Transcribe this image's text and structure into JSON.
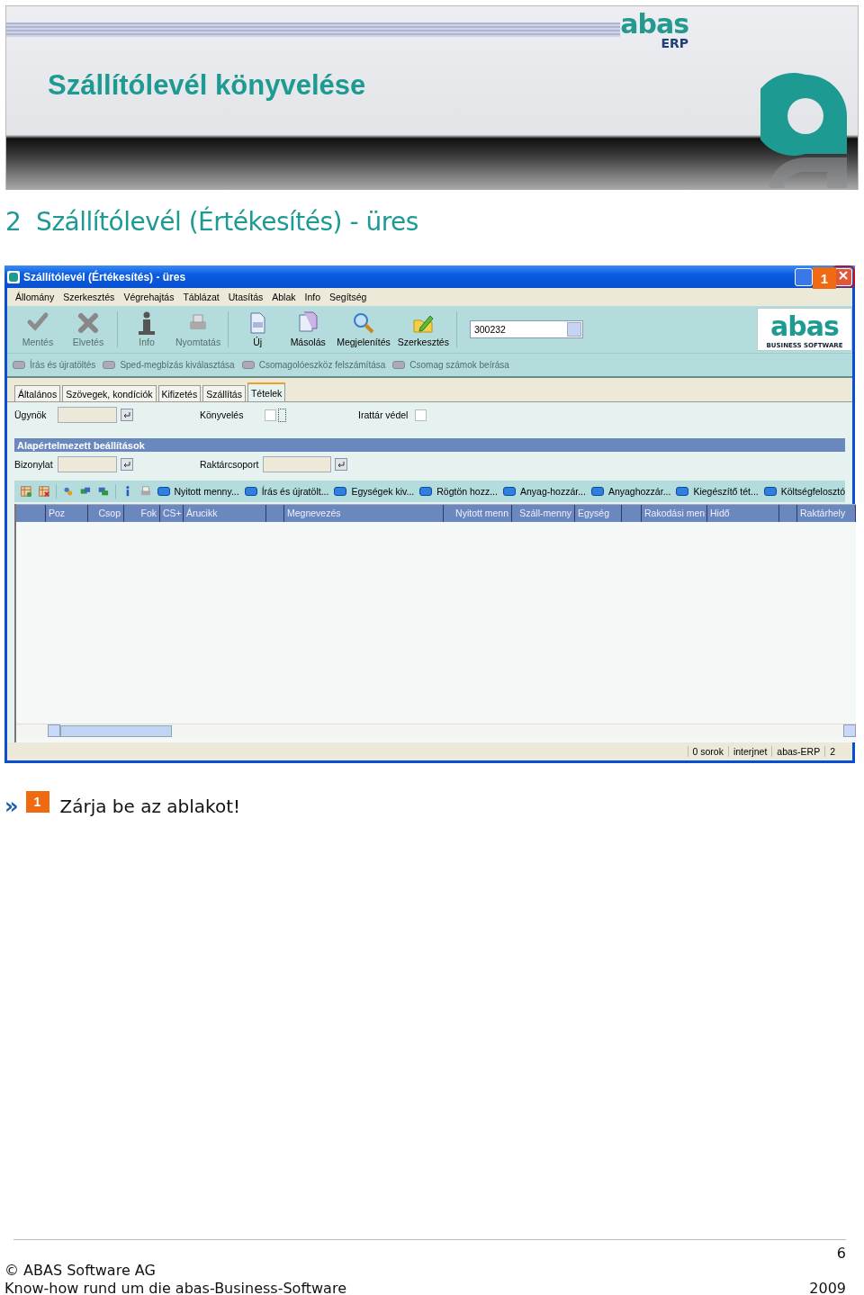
{
  "slide_header": {
    "title": "Szállítólevél könyvelése",
    "logo": "abas",
    "logo_sub": "ERP"
  },
  "section_heading": "2  Szállítólevél (Értékesítés) - üres",
  "window": {
    "title": "Szállítólevél (Értékesítés) - üres",
    "callout": "1",
    "menu": [
      "Állomány",
      "Szerkesztés",
      "Végrehajtás",
      "Táblázat",
      "Utasítás",
      "Ablak",
      "Info",
      "Segítség"
    ],
    "toolbar": [
      {
        "label": "Mentés",
        "disabled": true
      },
      {
        "label": "Elvetés",
        "disabled": true
      },
      {
        "label": "Info",
        "disabled": true
      },
      {
        "label": "Nyomtatás",
        "disabled": true
      },
      {
        "label": "Új",
        "disabled": false
      },
      {
        "label": "Másolás",
        "disabled": false
      },
      {
        "label": "Megjelenítés",
        "disabled": false
      },
      {
        "label": "Szerkesztés",
        "disabled": false
      }
    ],
    "record_number": "300232",
    "brand": {
      "name": "abas",
      "tagline": "BUSINESS SOFTWARE"
    },
    "actions": [
      {
        "label": "Írás és újratöltés",
        "disabled": true
      },
      {
        "label": "Sped-megbízás kiválasztása",
        "disabled": true
      },
      {
        "label": "Csomagolóeszköz felszámítása",
        "disabled": true
      },
      {
        "label": "Csomag számok beírása",
        "disabled": true
      }
    ],
    "tabs": [
      {
        "label": "Általános",
        "selected": false
      },
      {
        "label": "Szövegek, kondíciók",
        "selected": false
      },
      {
        "label": "Kifizetés",
        "selected": false
      },
      {
        "label": "Szállítás",
        "selected": false
      },
      {
        "label": "Tételek",
        "selected": true
      }
    ],
    "agent_label": "Ügynök",
    "booking": {
      "label": "Könyvelés",
      "checked": false
    },
    "archive": {
      "label": "Irattár védel",
      "checked": false
    },
    "defaults_heading": "Alapértelmezett beállítások",
    "document_label": "Bizonylat",
    "warehouse_group_label": "Raktárcsoport",
    "grid_buttons": [
      "Nyitott menny...",
      "Írás és újratölt...",
      "Egységek kiv...",
      "Rögtön hozz...",
      "Anyag-hozzár...",
      "Anyaghozzár...",
      "Kiegészítő tét...",
      "Költségfelosztó"
    ],
    "columns": [
      {
        "kind": "blank"
      },
      {
        "kind": "text",
        "label": "Poz"
      },
      {
        "kind": "text",
        "label": "Csop"
      },
      {
        "kind": "text",
        "label": "Fok"
      },
      {
        "kind": "text",
        "label": "CS+"
      },
      {
        "kind": "text",
        "label": "Árucikk"
      },
      {
        "kind": "blank"
      },
      {
        "kind": "text",
        "label": "Megnevezés"
      },
      {
        "kind": "text",
        "label": "Nyitott menn"
      },
      {
        "kind": "text",
        "label": "Száll-menny"
      },
      {
        "kind": "text",
        "label": "Egység"
      },
      {
        "kind": "blank"
      },
      {
        "kind": "text",
        "label": "Rakodási men"
      },
      {
        "kind": "text",
        "label": "Hidő"
      },
      {
        "kind": "blank"
      },
      {
        "kind": "text",
        "label": "Raktárhely"
      }
    ],
    "status_bar": [
      "0 sorok",
      "interjnet",
      "abas-ERP",
      "2"
    ]
  },
  "instruction": {
    "marker": "»",
    "badge": "1",
    "text": "Zárja be az ablakot!"
  },
  "footer": {
    "page": "6",
    "copyright": "© ABAS Software AG",
    "tagline": "Know-how rund um die abas-Business-Software",
    "year": "2009"
  }
}
